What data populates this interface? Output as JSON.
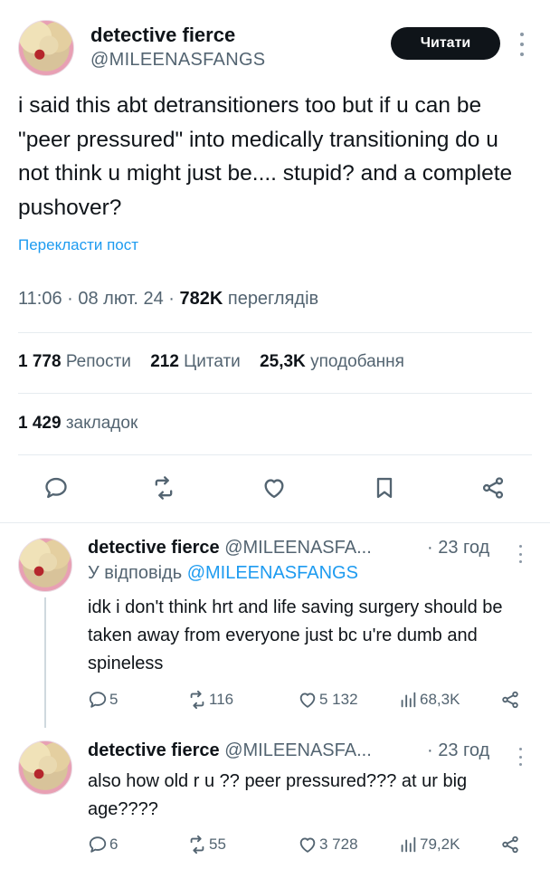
{
  "tweet": {
    "author_name": "detective fierce",
    "author_handle": "@MILEENASFANGS",
    "follow_label": "Читати",
    "text": "i said this abt detransitioners too but if u can be \"peer pressured\" into medically transitioning do u not think u might just be.... stupid? and a complete pushover?",
    "translate_label": "Перекласти пост",
    "time": "11:06",
    "date": "08 лют. 24",
    "views_count": "782K",
    "views_label": "переглядів",
    "reposts_count": "1 778",
    "reposts_label": "Репости",
    "quotes_count": "212",
    "quotes_label": "Цитати",
    "likes_count": "25,3K",
    "likes_label": "уподобання",
    "bookmarks_count": "1 429",
    "bookmarks_label": "закладок"
  },
  "replies": [
    {
      "name": "detective fierce",
      "handle": "@MILEENASFA...",
      "time": "· 23 год",
      "reply_to_prefix": "У відповідь",
      "reply_to_handle": "@MILEENASFANGS",
      "text": "idk i don't think hrt and life saving surgery should be taken away from everyone just bc u're dumb and spineless",
      "replies": "5",
      "reposts": "116",
      "likes": "5 132",
      "views": "68,3K"
    },
    {
      "name": "detective fierce",
      "handle": "@MILEENASFA...",
      "time": "· 23 год",
      "text": "also how old r u ?? peer pressured??? at ur big age????",
      "replies": "6",
      "reposts": "55",
      "likes": "3 728",
      "views": "79,2K"
    }
  ],
  "icons": {
    "reply": "speech-bubble-icon",
    "repost": "repost-arrows-icon",
    "like": "heart-icon",
    "bookmark": "bookmark-icon",
    "share": "share-icon",
    "views": "bar-chart-icon",
    "more": "more-dots-icon"
  },
  "colors": {
    "text": "#0f1419",
    "secondary": "#536471",
    "link": "#1d9bf0",
    "button_bg": "#0f1419",
    "divider": "#e6ecf0"
  }
}
